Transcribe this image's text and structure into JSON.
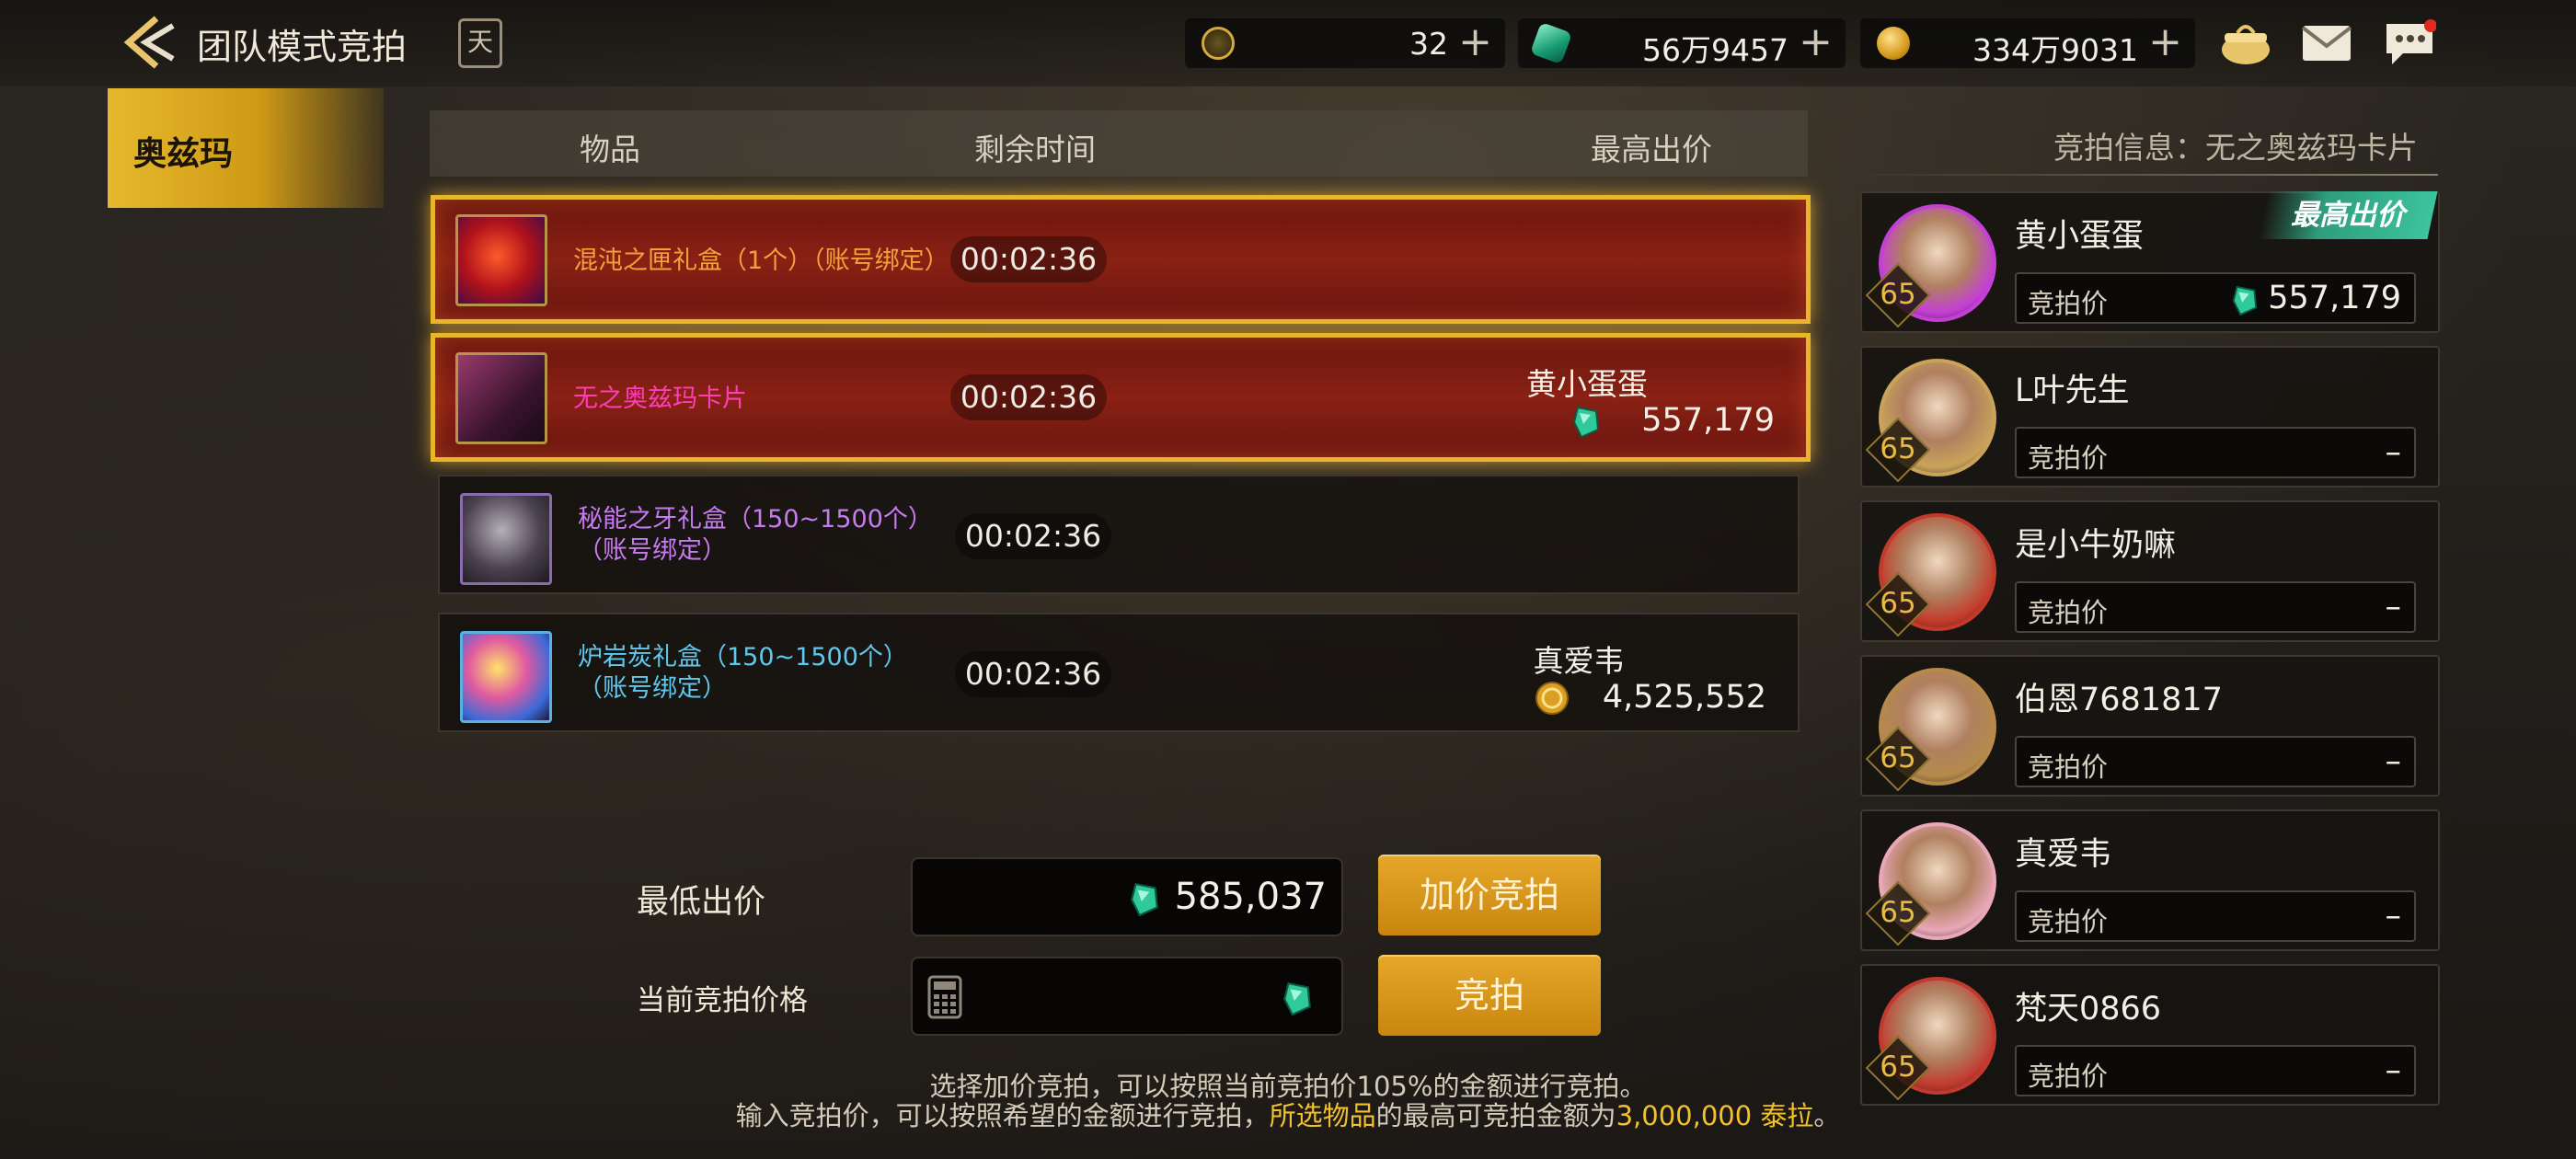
{
  "header": {
    "title": "团队模式竞拍",
    "calendar_label": "天",
    "currencies": [
      {
        "icon": "moon-coin-icon",
        "value": "32"
      },
      {
        "icon": "green-gem-icon",
        "value": "56万9457"
      },
      {
        "icon": "gold-coin-icon",
        "value": "334万9031"
      }
    ]
  },
  "sidebar": {
    "tab_label": "奥兹玛"
  },
  "list": {
    "col_item": "物品",
    "col_time": "剩余时间",
    "col_bid": "最高出价",
    "items": [
      {
        "name": "混沌之匣礼盒（1个）（账号绑定）",
        "name_color": "#f2a23c",
        "time": "00:02:36",
        "bidder": "",
        "bid": "",
        "bid_currency": ""
      },
      {
        "name": "无之奥兹玛卡片",
        "name_color": "#ff3db8",
        "time": "00:02:36",
        "bidder": "黄小蛋蛋",
        "bid": "557,179",
        "bid_currency": "green-gem-icon"
      },
      {
        "name": "秘能之牙礼盒（150~1500个）\n（账号绑定）",
        "name_color": "#c77bf0",
        "time": "00:02:36",
        "bidder": "",
        "bid": "",
        "bid_currency": ""
      },
      {
        "name": "炉岩炭礼盒（150~1500个）\n（账号绑定）",
        "name_color": "#5ec8ee",
        "time": "00:02:36",
        "bidder": "真爱韦",
        "bid": "4,525,552",
        "bid_currency": "gold-coin-icon"
      }
    ]
  },
  "bid_form": {
    "min_bid_label": "最低出价",
    "min_bid_value": "585,037",
    "raise_button": "加价竞拍",
    "current_bid_label": "当前竞拍价格",
    "bid_button": "竞拍",
    "hint_line1": "选择加价竞拍，可以按照当前竞拍价105%的金额进行竞拍。",
    "hint_line2_a": "输入竞拍价，可以按照希望的金额进行竞拍，",
    "hint_line2_hl1": "所选物品",
    "hint_line2_b": "的最高可竞拍金额为",
    "hint_line2_hl2": "3,000,000 泰拉",
    "hint_line2_c": "。"
  },
  "bid_info": {
    "title": "竞拍信息：无之奥兹玛卡片",
    "top_badge": "最高出价",
    "bid_label": "竞拍价",
    "bidders": [
      {
        "name": "黄小蛋蛋",
        "level": "65",
        "bid": "557,179",
        "avatar_color": "#c43fd6"
      },
      {
        "name": "L叶先生",
        "level": "65",
        "bid": "–",
        "avatar_color": "#c9a35a"
      },
      {
        "name": "是小牛奶嘛",
        "level": "65",
        "bid": "–",
        "avatar_color": "#c43a2a"
      },
      {
        "name": "伯恩7681817",
        "level": "65",
        "bid": "–",
        "avatar_color": "#b58a4a"
      },
      {
        "name": "真爱韦",
        "level": "65",
        "bid": "–",
        "avatar_color": "#e9a7b8"
      },
      {
        "name": "梵天0866",
        "level": "65",
        "bid": "–",
        "avatar_color": "#c23a2f"
      }
    ]
  }
}
